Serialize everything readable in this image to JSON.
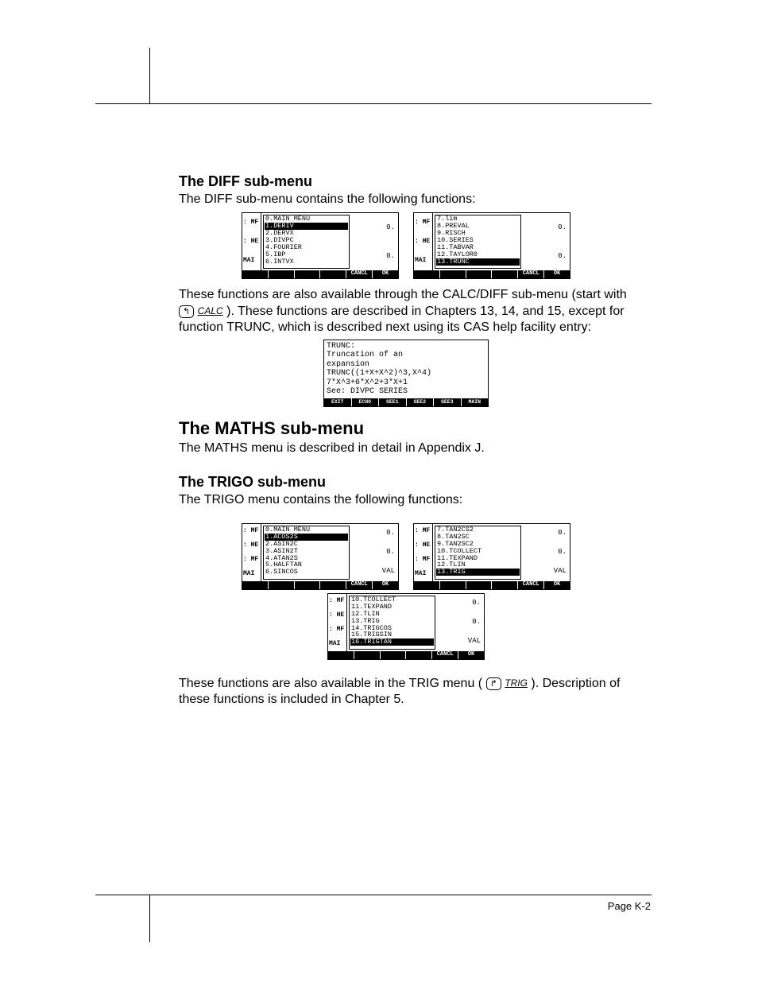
{
  "page_number": "Page K-2",
  "diff": {
    "heading": "The DIFF sub-menu",
    "intro": "The DIFF sub-menu contains the following functions:",
    "screen1": {
      "left_labels": [
        ": MF",
        ": HE",
        "MAI"
      ],
      "menu": [
        "0.MAIN MENU",
        "1.DERIV",
        "2.DERVX",
        "3.DIVPC",
        "4.FOURIER",
        "5.IBP",
        "6.INTVX"
      ],
      "highlight_index": 1,
      "right_values": [
        "0.",
        "0."
      ],
      "softkeys": [
        "",
        "",
        "",
        "",
        "CANCL",
        "OK"
      ]
    },
    "screen2": {
      "left_labels": [
        ": MF",
        ": HE",
        "MAI"
      ],
      "menu": [
        "7.lim",
        "8.PREVAL",
        "9.RISCH",
        "10.SERIES",
        "11.TABVAR",
        "12.TAYLOR0",
        "13.TRUNC"
      ],
      "highlight_index": 6,
      "right_values": [
        "0.",
        "0."
      ],
      "softkeys": [
        "",
        "",
        "",
        "",
        "CANCL",
        "OK"
      ]
    },
    "para1a": "These functions are also available through the CALC/DIFF sub-menu (start with ",
    "key_left": "↰",
    "key_label": "CALC",
    "para1b": " ).  These functions are described in Chapters 13, 14, and 15, except for function TRUNC, which is described next using its CAS help facility entry:",
    "help": {
      "lines": [
        "TRUNC:",
        "Truncation of an",
        "expansion",
        "TRUNC((1+X+X^2)^3,X^4)",
        "   7*X^3+6*X^2+3*X+1",
        "",
        "See: DIVPC SERIES"
      ],
      "softkeys": [
        "EXIT",
        "ECHO",
        "SEE1",
        "SEE2",
        "SEE3",
        "MAIN"
      ]
    }
  },
  "maths": {
    "heading": "The MATHS sub-menu",
    "text": "The MATHS menu is described in detail in Appendix J."
  },
  "trigo": {
    "heading": "The TRIGO sub-menu",
    "intro": "The TRIGO menu contains the following functions:",
    "screen1": {
      "left_labels": [
        ": MF",
        ": HE",
        ": MF",
        "MAI"
      ],
      "menu": [
        "0.MAIN MENU",
        "1.ACOS2S",
        "2.ASIN2C",
        "3.ASIN2T",
        "4.ATAN2S",
        "5.HALFTAN",
        "6.SINCOS"
      ],
      "highlight_index": 1,
      "right_values": [
        "0.",
        "0.",
        "VAL"
      ],
      "softkeys": [
        "",
        "",
        "",
        "",
        "CANCL",
        "OK"
      ]
    },
    "screen2": {
      "left_labels": [
        ": MF",
        ": HE",
        ": MF",
        "MAI"
      ],
      "menu": [
        "7.TAN2CS2",
        "8.TAN2SC",
        "9.TAN2SC2",
        "10.TCOLLECT",
        "11.TEXPAND",
        "12.TLIN",
        "13.TRIG"
      ],
      "highlight_index": 6,
      "right_values": [
        "0.",
        "0.",
        "VAL"
      ],
      "softkeys": [
        "",
        "",
        "",
        "",
        "CANCL",
        "OK"
      ]
    },
    "screen3": {
      "left_labels": [
        ": MF",
        ": HE",
        ": MF",
        "MAI"
      ],
      "menu": [
        "10.TCOLLECT",
        "11.TEXPAND",
        "12.TLIN",
        "13.TRIG",
        "14.TRIGCOS",
        "15.TRIGSIN",
        "16.TRIGTAN"
      ],
      "highlight_index": 6,
      "right_values": [
        "0.",
        "0.",
        "VAL"
      ],
      "softkeys": [
        "",
        "",
        "",
        "",
        "CANCL",
        "OK"
      ]
    },
    "para_a": "These functions are also available in the TRIG menu (",
    "key_right": "↱",
    "key_label": "TRIG",
    "para_b": " ).  Description of these functions is included in Chapter 5."
  }
}
